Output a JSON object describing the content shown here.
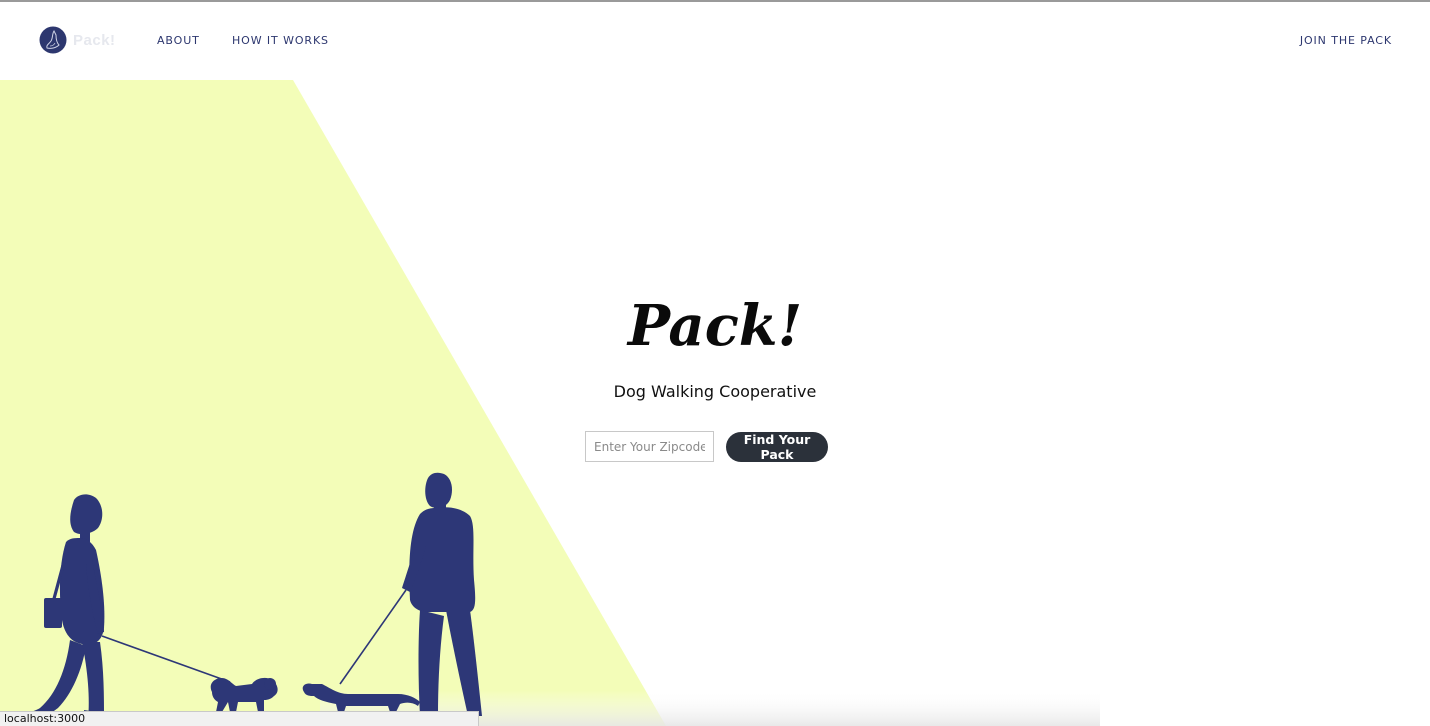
{
  "nav": {
    "brand_text": "Pack!",
    "about_label": "ABOUT",
    "how_label": "HOW IT WORKS",
    "join_label": "JOIN THE PACK"
  },
  "hero": {
    "title": "Pack!",
    "subtitle": "Dog Walking Cooperative",
    "zip_placeholder": "Enter Your Zipcode",
    "zip_value": "",
    "button_label": "Find Your Pack"
  },
  "status_bar": {
    "url": "localhost:3000"
  },
  "colors": {
    "brand_navy": "#2d376f",
    "accent_yellow": "#f3fdb8",
    "button_dark": "#2b313a",
    "background": "#ffffff"
  },
  "icons": {
    "logo": "dog-head-logo-icon"
  }
}
